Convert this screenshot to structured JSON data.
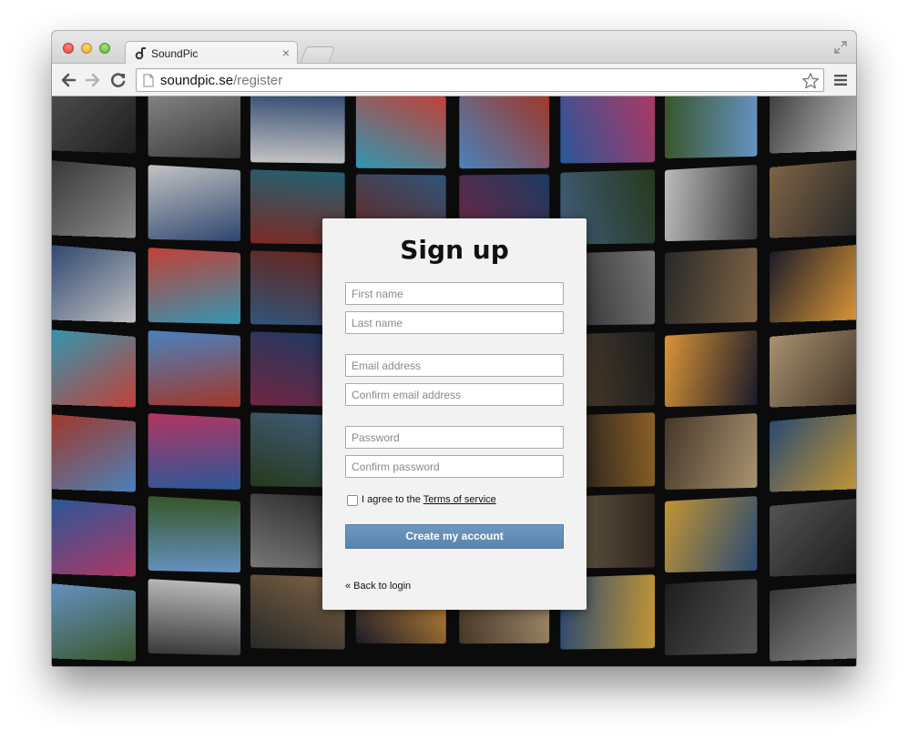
{
  "browser": {
    "tab_title": "SoundPic",
    "tab_close": "×",
    "url_host": "soundpic.se",
    "url_path": "/register"
  },
  "signup": {
    "title": "Sign up",
    "first_name_placeholder": "First name",
    "last_name_placeholder": "Last name",
    "email_placeholder": "Email address",
    "confirm_email_placeholder": "Confirm email address",
    "password_placeholder": "Password",
    "confirm_password_placeholder": "Confirm password",
    "terms_prefix": "I agree to the ",
    "terms_link": "Terms of service",
    "create_button": "Create my account",
    "back_link": "« Back to login",
    "button_color": "#5f8bb5"
  }
}
